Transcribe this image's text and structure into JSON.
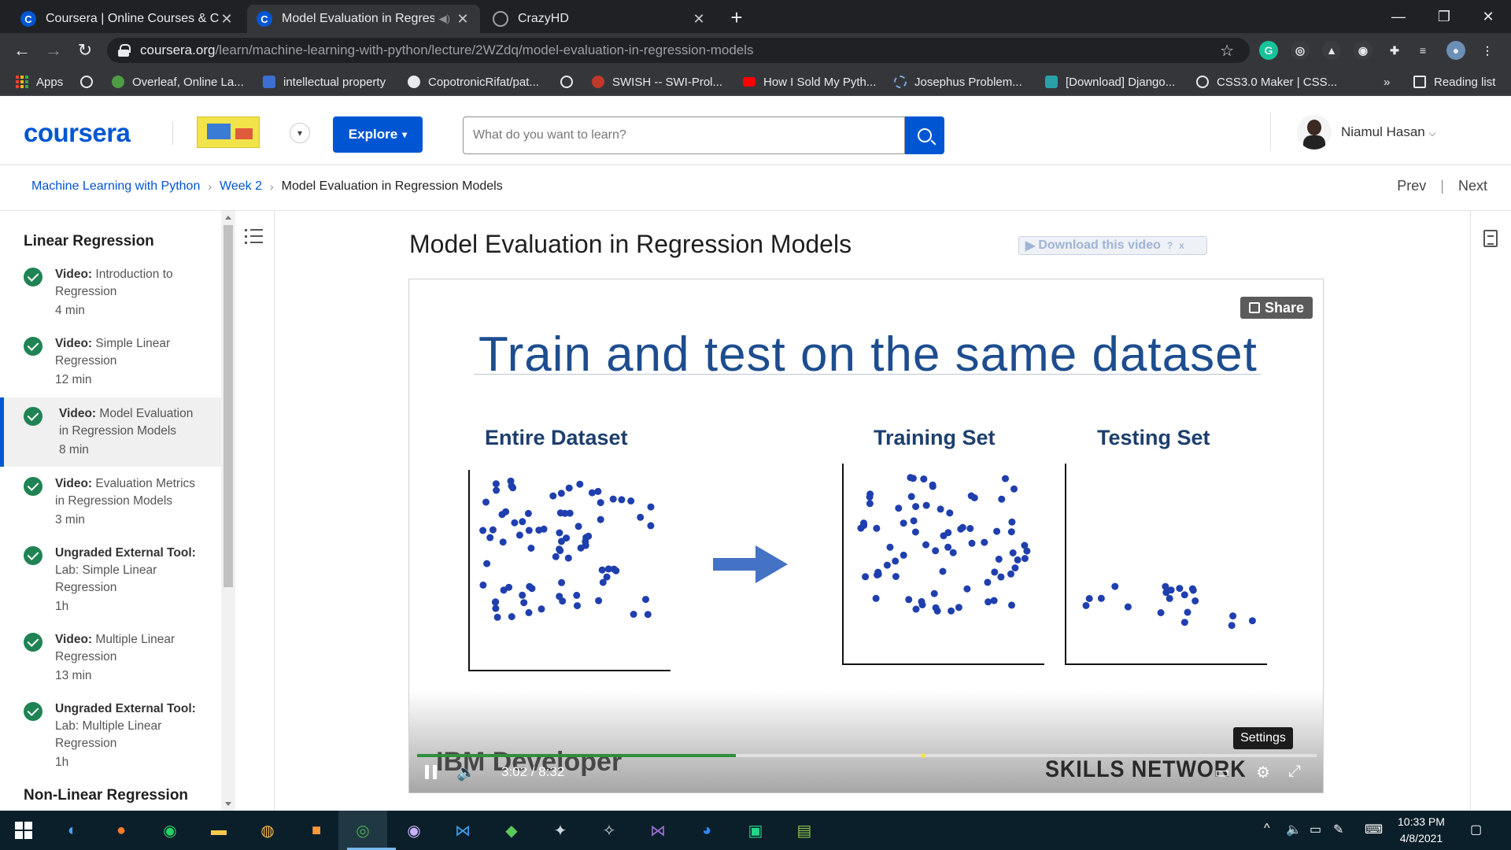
{
  "browser": {
    "tabs": [
      {
        "title": "Coursera | Online Courses & Crec",
        "active": false
      },
      {
        "title": "Model Evaluation in Regressi",
        "active": true
      },
      {
        "title": "CrazyHD",
        "active": false
      }
    ],
    "url_host": "coursera.org",
    "url_path": "/learn/machine-learning-with-python/lecture/2WZdq/model-evaluation-in-regression-models",
    "bookmarks": [
      "Apps",
      "Overleaf, Online La...",
      "intellectual property",
      "CopotronicRifat/pat...",
      "SWISH -- SWI-Prol...",
      "How I Sold My Pyth...",
      "Josephus Problem...",
      "[Download] Django...",
      "CSS3.0 Maker | CSS..."
    ],
    "reading_list": "Reading list",
    "overflow": "»"
  },
  "header": {
    "logo": "coursera",
    "explore_label": "Explore",
    "search_placeholder": "What do you want to learn?",
    "user_name": "Niamul Hasan"
  },
  "breadcrumb": {
    "course": "Machine Learning with Python",
    "week": "Week 2",
    "current": "Model Evaluation in Regression Models"
  },
  "nav": {
    "prev": "Prev",
    "next": "Next"
  },
  "sidebar": {
    "section1": "Linear Regression",
    "items": [
      {
        "type": "Video:",
        "title": "Introduction to Regression",
        "duration": "4 min"
      },
      {
        "type": "Video:",
        "title": "Simple Linear Regression",
        "duration": "12 min"
      },
      {
        "type": "Video:",
        "title": "Model Evaluation in Regression Models",
        "duration": "8 min"
      },
      {
        "type": "Video:",
        "title": "Evaluation Metrics in Regression Models",
        "duration": "3 min"
      },
      {
        "type": "Ungraded External Tool:",
        "title": "Lab: Simple Linear Regression",
        "duration": "1h"
      },
      {
        "type": "Video:",
        "title": "Multiple Linear Regression",
        "duration": "13 min"
      },
      {
        "type": "Ungraded External Tool:",
        "title": "Lab: Multiple Linear Regression",
        "duration": "1h"
      }
    ],
    "section2": "Non-Linear Regression"
  },
  "main": {
    "lecture_title": "Model Evaluation in Regression Models",
    "download_label": "Download this video",
    "download_help": "?",
    "download_close": "x"
  },
  "video": {
    "share_label": "Share",
    "slide_title": "Train and test on the same dataset",
    "panel_entire": "Entire Dataset",
    "panel_training": "Training Set",
    "panel_testing": "Testing Set",
    "brand_left": "IBM Developer",
    "brand_right": "SKILLS NETWORK",
    "current_time": "3:02",
    "time_sep": "/",
    "duration": "8:32",
    "progress_fraction": 0.354,
    "marker_fraction": 0.56,
    "settings_tooltip": "Settings",
    "dot_color": "#1f3fae",
    "arrow_color": "#4472c4"
  },
  "taskbar": {
    "time": "10:33 PM",
    "date": "4/8/2021"
  }
}
